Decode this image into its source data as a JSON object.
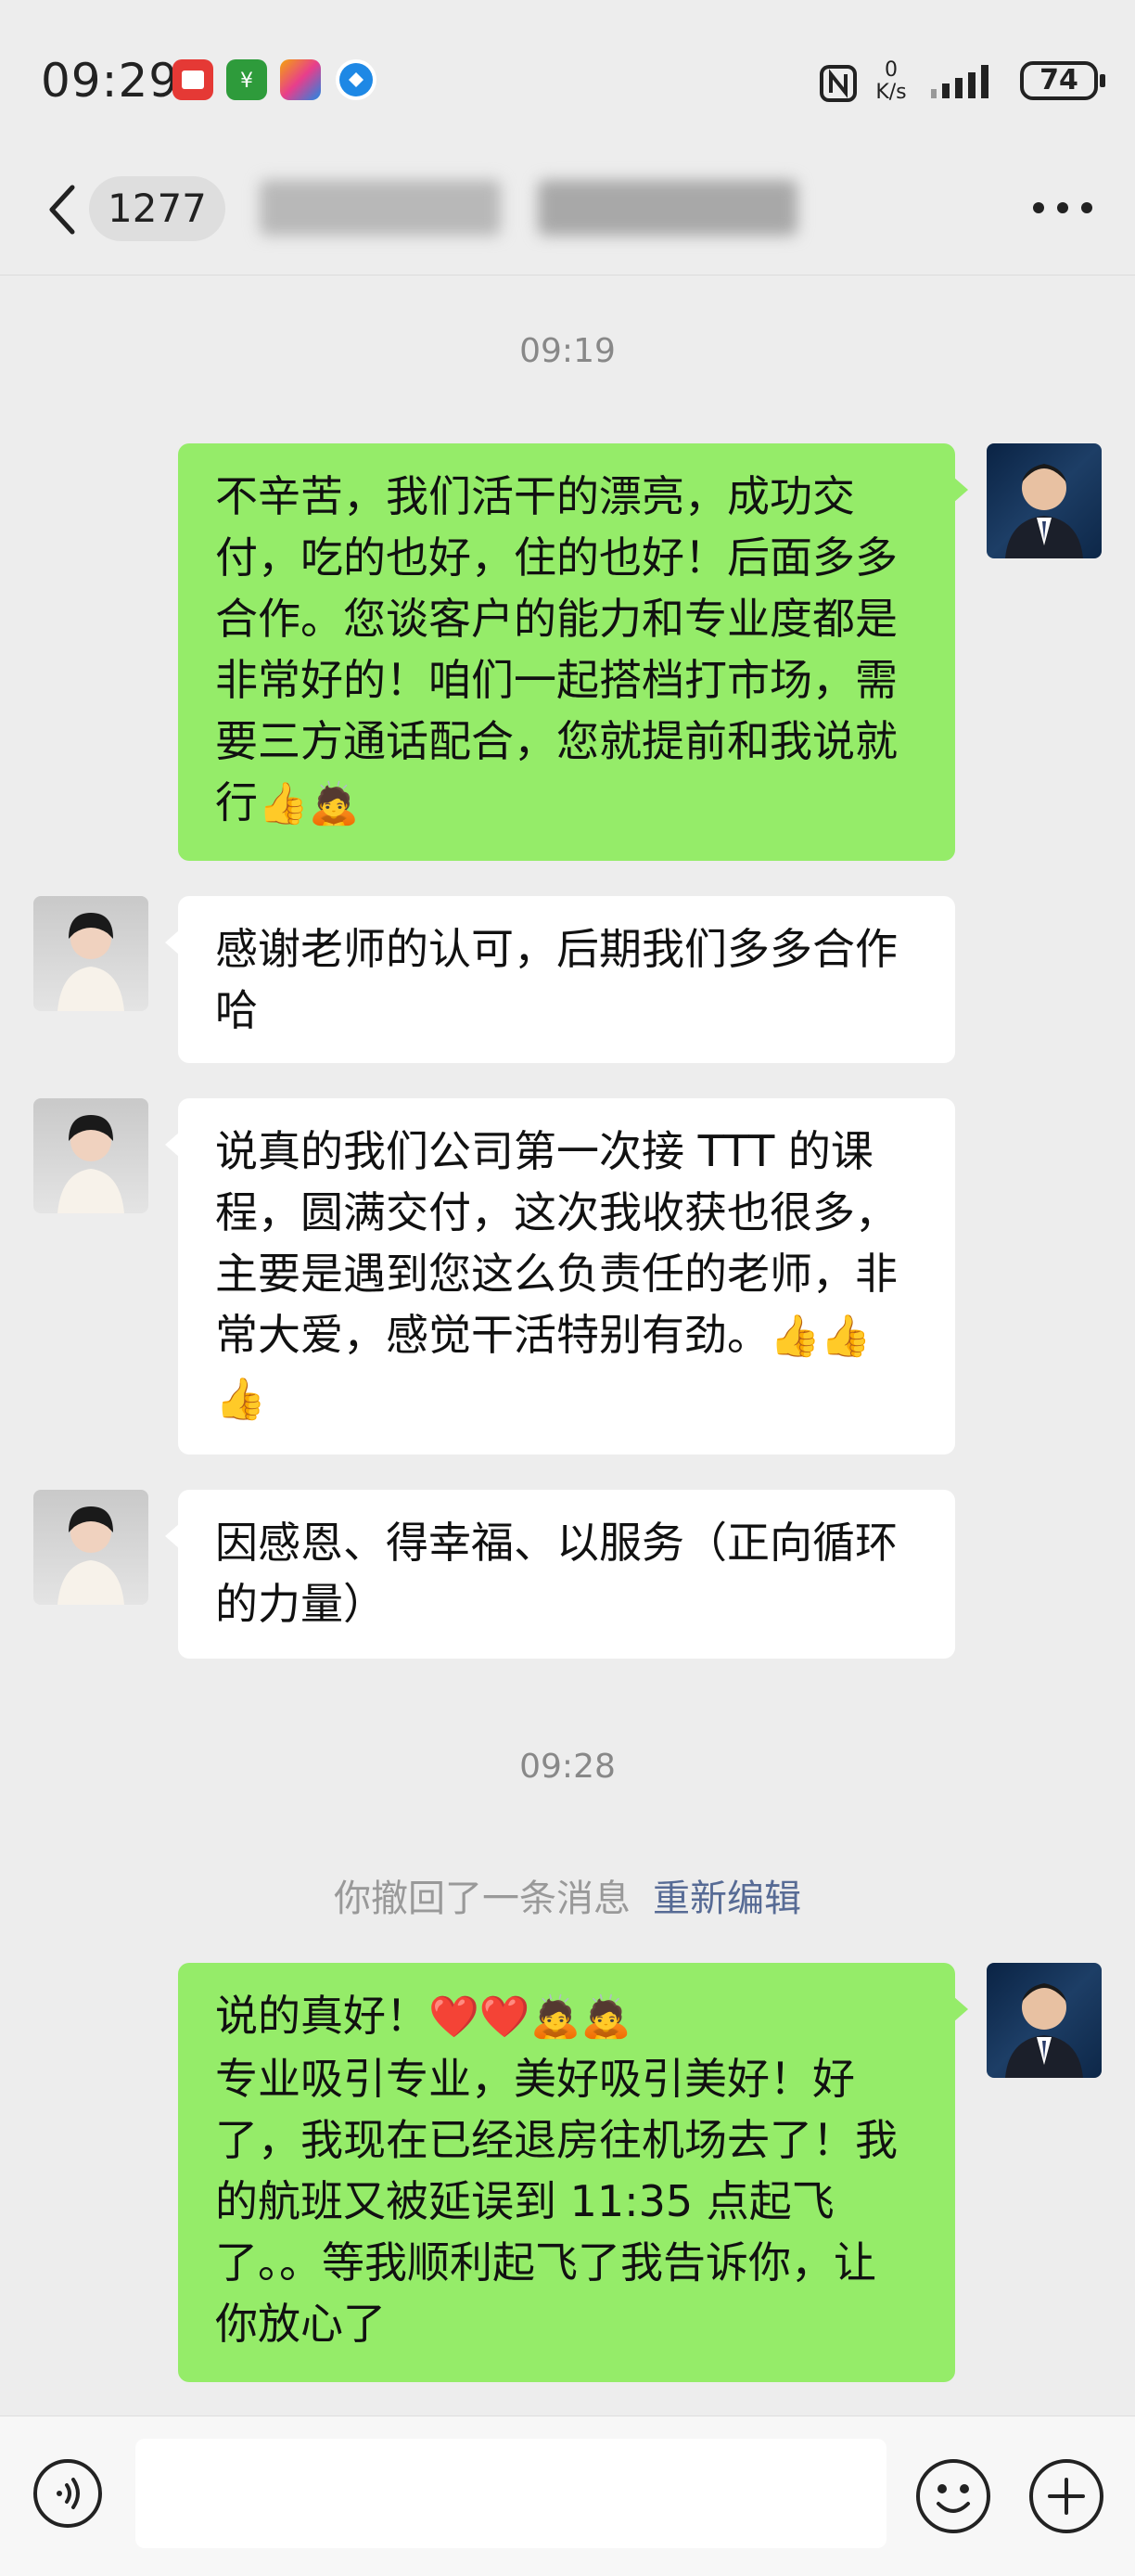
{
  "status_bar": {
    "time": "09:29",
    "speed_value": "0",
    "speed_unit": "K/s",
    "battery": "74",
    "apps": [
      {
        "name": "red-app-icon",
        "color": "#e53935"
      },
      {
        "name": "green-app-icon",
        "color": "#2e9b3b"
      },
      {
        "name": "colorful-app-icon",
        "color": "#f4a30c"
      },
      {
        "name": "blue-app-icon",
        "color": "#1e88e5"
      }
    ]
  },
  "nav": {
    "unread_count": "1277"
  },
  "timestamps": [
    "09:19",
    "09:28"
  ],
  "messages": [
    {
      "id": "m1",
      "from": "me",
      "text": "不辛苦，我们活干的漂亮，成功交付，吃的也好，住的也好！后面多多合作。您谈客户的能力和专业度都是非常好的！咱们一起搭档打市场，需要三方通话配合，您就提前和我说就行",
      "emoji": "👍🙇"
    },
    {
      "id": "m2",
      "from": "them",
      "text": "感谢老师的认可，后期我们多多合作哈",
      "emoji": ""
    },
    {
      "id": "m3",
      "from": "them",
      "text": "说真的我们公司第一次接 TTT 的课程，圆满交付，这次我收获也很多，主要是遇到您这么负责任的老师，非常大爱，感觉干活特别有劲。",
      "emoji": "👍👍👍"
    },
    {
      "id": "m4",
      "from": "them",
      "text": "因感恩、得幸福、以服务（正向循环的力量）",
      "emoji": ""
    },
    {
      "id": "m5",
      "from": "me",
      "text_line1": "说的真好！",
      "emoji_line1": "❤️❤️🙇🙇",
      "text": "专业吸引专业，美好吸引美好！好了，我现在已经退房往机场去了！我的航班又被延误到 11:35 点起飞了。。等我顺利起飞了我告诉你，让你放心了"
    }
  ],
  "recall": {
    "text": "你撤回了一条消息",
    "action": "重新编辑"
  }
}
